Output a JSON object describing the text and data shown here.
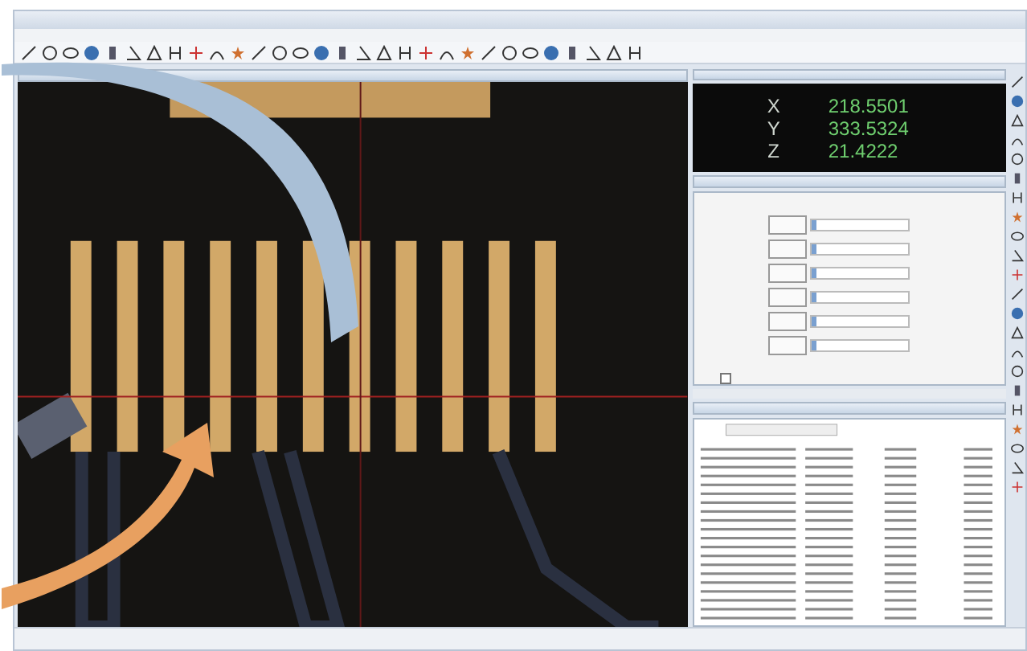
{
  "dro": {
    "axes": [
      {
        "label": "X",
        "value": "218.5501"
      },
      {
        "label": "Y",
        "value": "333.5324"
      },
      {
        "label": "Z",
        "value": "21.4222"
      }
    ]
  },
  "light_control": {
    "sliders": [
      {
        "level": 0.05
      },
      {
        "level": 0.05
      },
      {
        "level": 0.05
      },
      {
        "level": 0.05
      },
      {
        "level": 0.05
      },
      {
        "level": 0.05
      }
    ],
    "checkbox": {
      "checked": false
    }
  },
  "overlay_arrows": [
    {
      "color": "#a9bfd6"
    },
    {
      "color": "#e8a060"
    }
  ]
}
